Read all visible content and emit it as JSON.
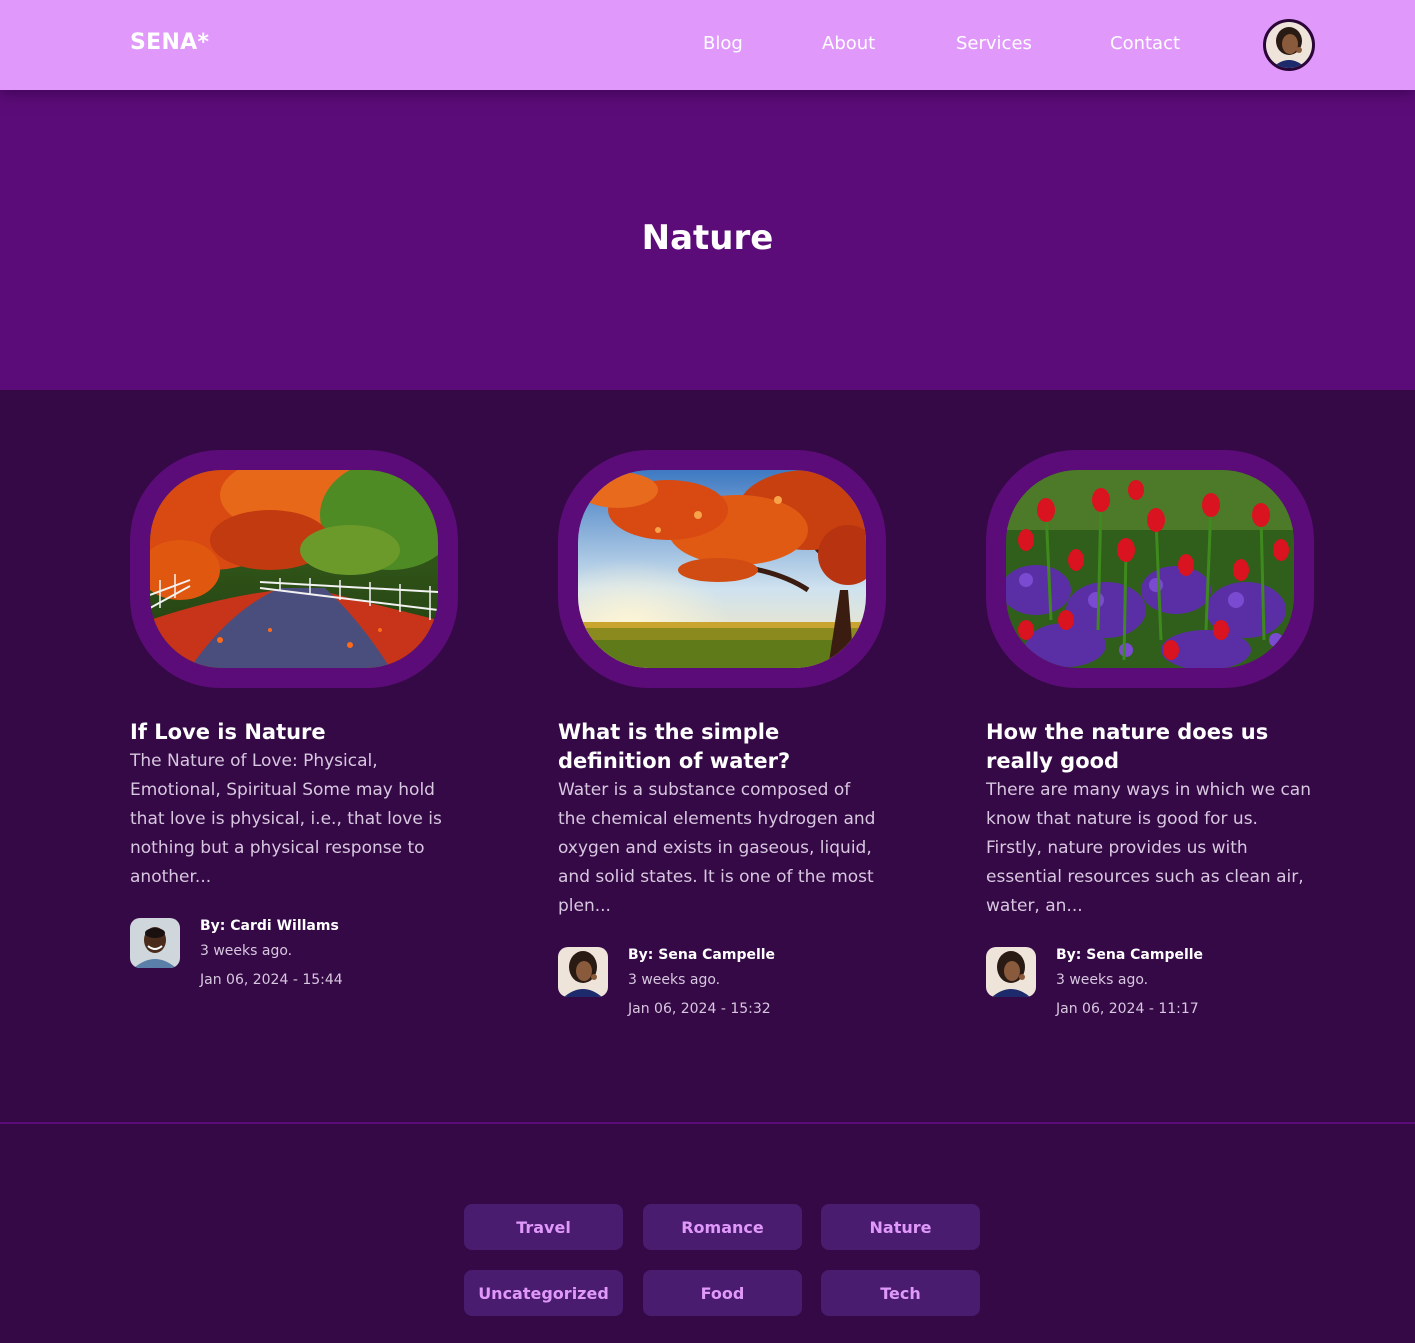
{
  "brand": {
    "logo": "SENA*"
  },
  "nav": {
    "blog": "Blog",
    "about": "About",
    "services": "Services",
    "contact": "Contact"
  },
  "colors": {
    "nav_bg": "#e099fa",
    "hero_bg": "#5c0c78",
    "page_bg": "#340945",
    "category_bg": "#4a1c70",
    "category_text": "#e099fa"
  },
  "hero": {
    "title": "Nature"
  },
  "posts": [
    {
      "title": "If Love is Nature",
      "excerpt": "The Nature of Love: Physical, Emotional, Spiritual Some may hold that love is physical, i.e., that love is nothing but a physical response to another...",
      "image": "autumn-path-fence",
      "author": "By: Cardi Willams",
      "ago": "3 weeks ago.",
      "date": "Jan 06, 2024 - 15:44"
    },
    {
      "title": "What is the simple definition of water?",
      "excerpt": "Water is a substance composed of the chemical elements hydrogen and oxygen and exists in gaseous, liquid, and solid states. It is one of the most plen...",
      "image": "autumn-tree-field",
      "author": "By: Sena Campelle",
      "ago": "3 weeks ago.",
      "date": "Jan 06, 2024 - 15:32"
    },
    {
      "title": "How the nature does us really good",
      "excerpt": "There are many ways in which we can know that nature is good for us. Firstly, nature provides us with essential resources such as clean air, water, an...",
      "image": "red-tulips-purple-flowers",
      "author": "By: Sena Campelle",
      "ago": "3 weeks ago.",
      "date": "Jan 06, 2024 - 11:17"
    }
  ],
  "categories": [
    "Travel",
    "Romance",
    "Nature",
    "Uncategorized",
    "Food",
    "Tech"
  ]
}
